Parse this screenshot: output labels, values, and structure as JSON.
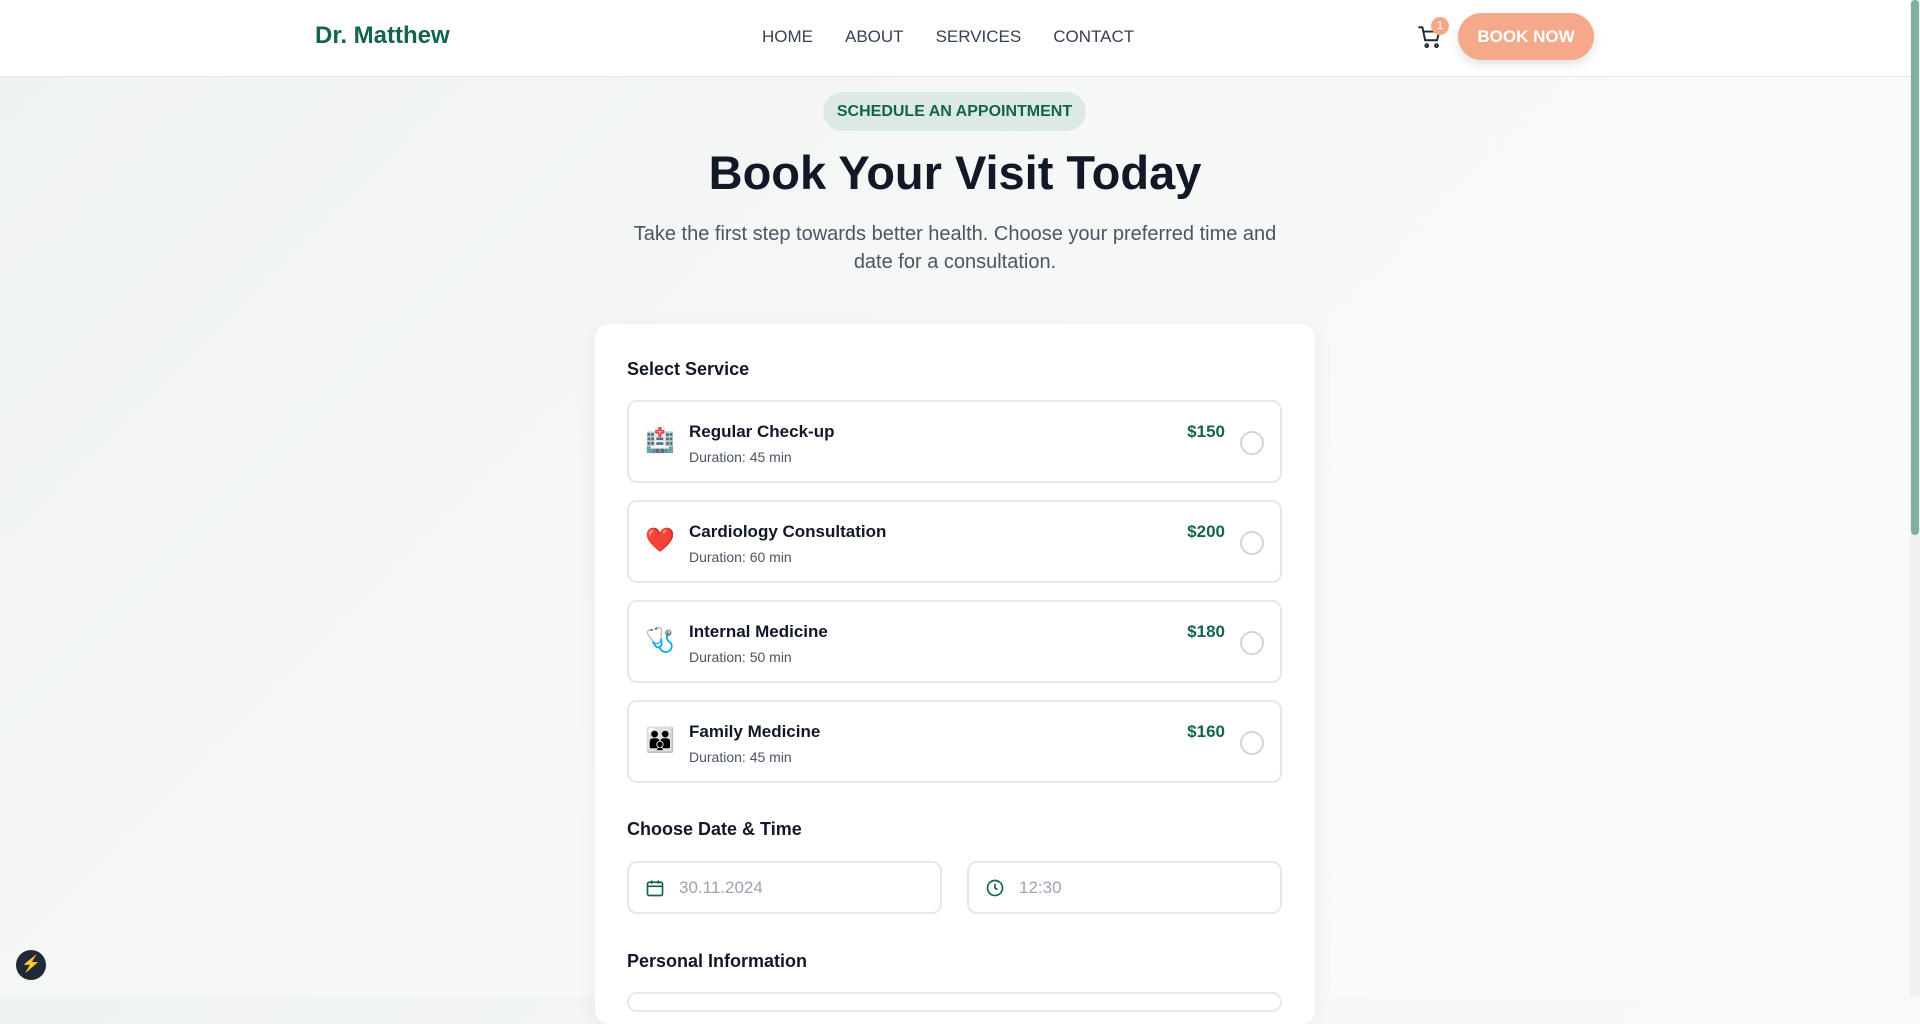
{
  "nav": {
    "logo": "Dr. Matthew",
    "links": [
      "HOME",
      "ABOUT",
      "SERVICES",
      "CONTACT"
    ],
    "cart_count": "1",
    "book_now": "BOOK NOW"
  },
  "hero": {
    "badge": "SCHEDULE AN APPOINTMENT",
    "title": "Book Your Visit Today",
    "subtitle": "Take the first step towards better health. Choose your preferred time and date for a consultation."
  },
  "form": {
    "select_service": "Select Service",
    "services": [
      {
        "icon": "hospital-icon",
        "emoji": "🏥",
        "name": "Regular Check-up",
        "duration": "Duration: 45 min",
        "price": "$150"
      },
      {
        "icon": "heart-icon",
        "emoji": "❤️",
        "name": "Cardiology Consultation",
        "duration": "Duration: 60 min",
        "price": "$200"
      },
      {
        "icon": "stethoscope-icon",
        "emoji": "🩺",
        "name": "Internal Medicine",
        "duration": "Duration: 50 min",
        "price": "$180"
      },
      {
        "icon": "family-icon",
        "emoji": "👪",
        "name": "Family Medicine",
        "duration": "Duration: 45 min",
        "price": "$160"
      }
    ],
    "date_time": "Choose Date & Time",
    "date_value": "30.11.2024",
    "time_value": "12:30",
    "personal": "Personal Information"
  },
  "colors": {
    "brand": "#14634f",
    "accent": "#f4a98a"
  }
}
